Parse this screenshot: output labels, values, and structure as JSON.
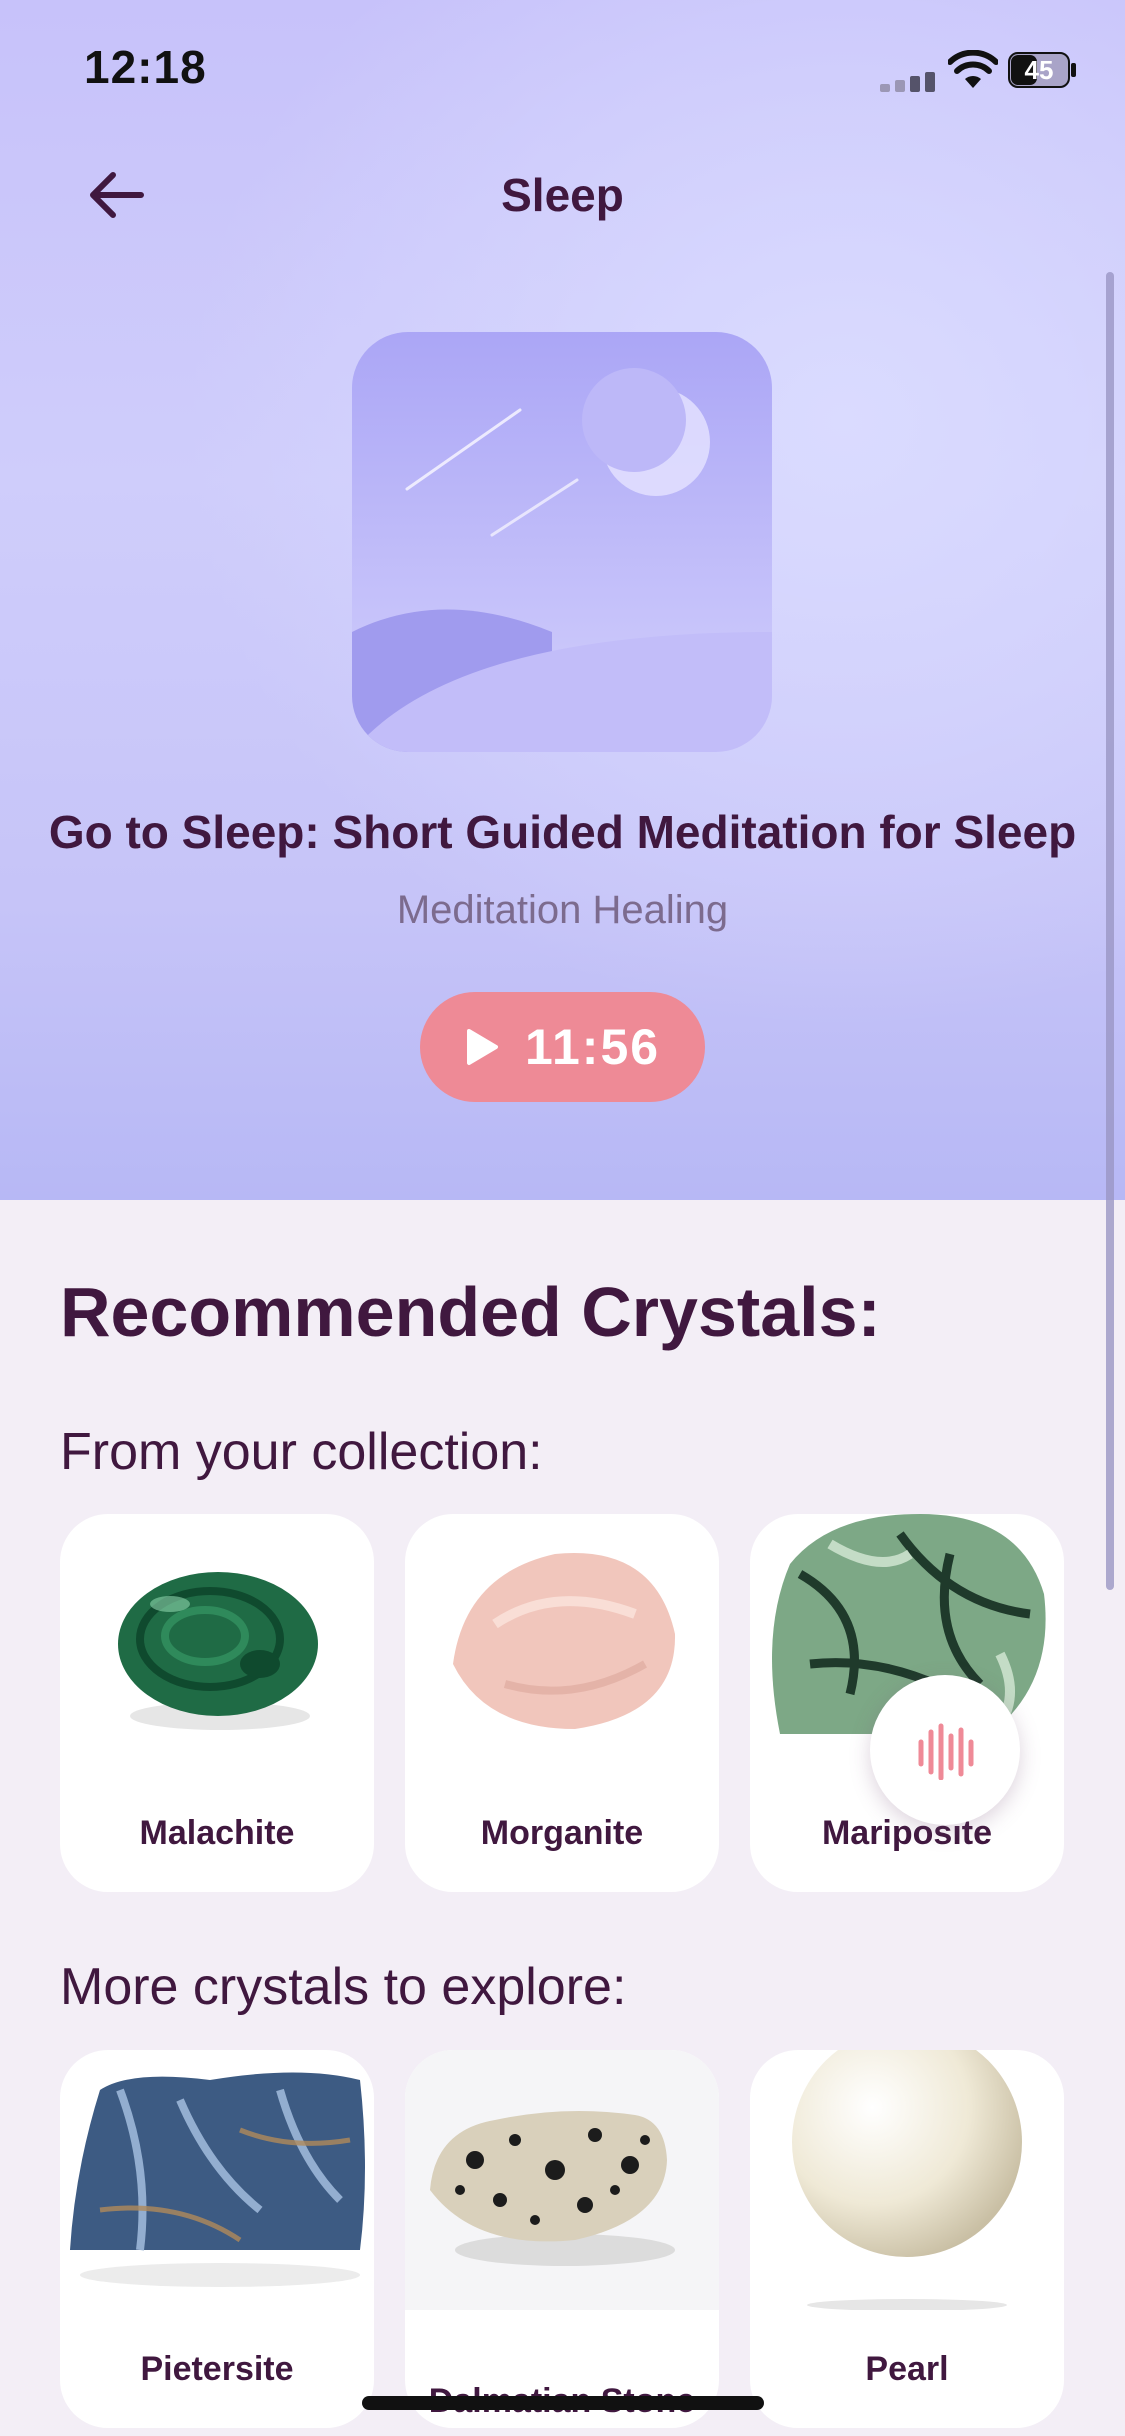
{
  "status_bar": {
    "time": "12:18",
    "battery": "45"
  },
  "header": {
    "title": "Sleep"
  },
  "track": {
    "title": "Go to Sleep: Short Guided Meditation for Sleep",
    "subtitle": "Meditation Healing",
    "duration": "11:56"
  },
  "recommended": {
    "heading": "Recommended Crystals:",
    "collection_heading": "From your collection:",
    "collection": [
      {
        "name": "Malachite",
        "color": "#1f6b45"
      },
      {
        "name": "Morganite",
        "color": "#f1c6bc"
      },
      {
        "name": "Mariposite",
        "color": "#6f9e79"
      }
    ],
    "explore_heading": "More crystals to explore:",
    "explore": [
      {
        "name": "Pietersite",
        "color": "#3d5b83"
      },
      {
        "name": "Dalmatian Stone",
        "color": "#d9d0bb"
      },
      {
        "name": "Pearl",
        "color": "#efe9d6"
      }
    ]
  },
  "colors": {
    "accent": "#ee8a96",
    "title_text": "#40183f",
    "hero_bg": "#c7c2fa",
    "page_bg": "#f3eef6"
  },
  "icons": {
    "back": "arrow-left-icon",
    "play": "play-icon",
    "voice": "audio-waveform-icon"
  }
}
